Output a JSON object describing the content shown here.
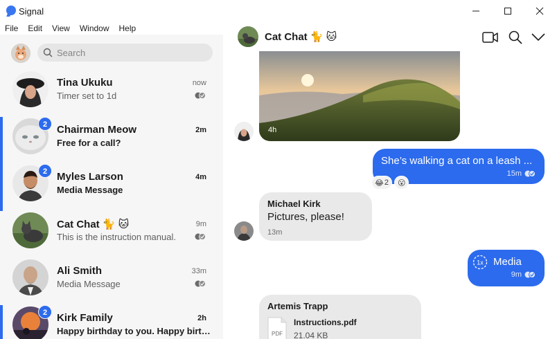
{
  "window": {
    "title": "Signal"
  },
  "menu": [
    "File",
    "Edit",
    "View",
    "Window",
    "Help"
  ],
  "search": {
    "placeholder": "Search"
  },
  "conversations": [
    {
      "name": "Tina Ukuku",
      "preview": "Timer set to 1d",
      "time": "now",
      "unread": null
    },
    {
      "name": "Chairman Meow",
      "preview": "Free for a call?",
      "time": "2m",
      "unread": "2"
    },
    {
      "name": "Myles Larson",
      "preview": "Media Message",
      "time": "4m",
      "unread": "2"
    },
    {
      "name": "Cat Chat 🐈 🐱",
      "preview": "This is the instruction manual.",
      "time": "9m",
      "unread": null
    },
    {
      "name": "Ali Smith",
      "preview": "Media Message",
      "time": "33m",
      "unread": null
    },
    {
      "name": "Kirk Family",
      "preview": "Happy birthday to you. Happy birthday to you.",
      "time": "2h",
      "unread": "2"
    }
  ],
  "chat": {
    "title": "Cat Chat 🐈 🐱",
    "messages": {
      "image_time": "4h",
      "outgoing_1": {
        "text": "She’s walking a cat on a leash ...",
        "time": "15m"
      },
      "reactions": [
        {
          "emoji": "😂",
          "count": "2"
        },
        {
          "emoji": "😮",
          "count": ""
        }
      ],
      "incoming_1": {
        "author": "Michael Kirk",
        "text": "Pictures, please!",
        "time": "13m"
      },
      "outgoing_2": {
        "badge": "1x",
        "text": "Media",
        "time": "9m"
      },
      "incoming_2": {
        "author": "Artemis Trapp",
        "file_type": "PDF",
        "file_name": "Instructions.pdf",
        "file_size": "21.04 KB"
      }
    }
  },
  "colors": {
    "accent": "#2c6bed",
    "sidebar_bg": "#f6f6f6",
    "incoming_bubble": "#e9e9e9"
  }
}
